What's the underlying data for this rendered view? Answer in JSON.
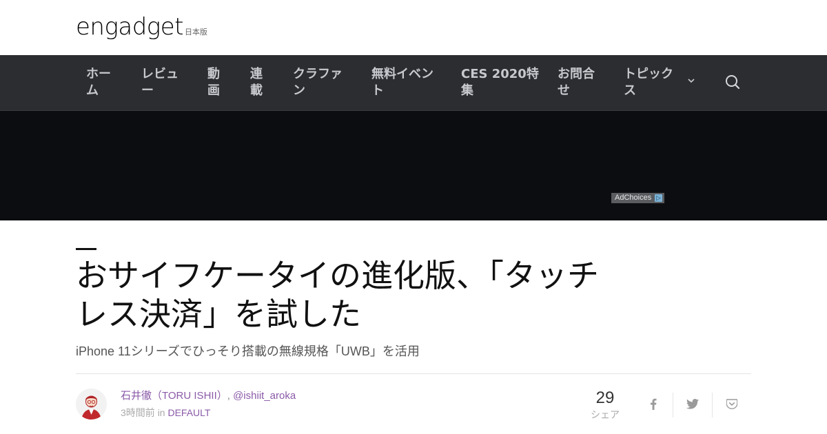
{
  "header": {
    "logo_text": "engadget",
    "edition": "日本版"
  },
  "nav": {
    "items": [
      {
        "line1": "ホー",
        "line2": "ム"
      },
      {
        "line1": "レビュ",
        "line2": "ー"
      },
      {
        "line1": "動",
        "line2": "画"
      },
      {
        "line1": "連",
        "line2": "載"
      },
      {
        "line1": "クラファ",
        "line2": "ン"
      },
      {
        "line1": "無料イベン",
        "line2": "ト"
      },
      {
        "line1": "CES 2020特",
        "line2": "集"
      },
      {
        "line1": "お問合",
        "line2": "せ"
      },
      {
        "line1": "トピック",
        "line2": "ス"
      }
    ],
    "dropdown_icon": "chevron-down-icon",
    "search_icon": "search-icon"
  },
  "ad": {
    "adchoices_label": "AdChoices",
    "adchoices_glyph": "▷"
  },
  "article": {
    "headline_line1": "おサイフケータイの進化版、「タッチ",
    "headline_line2": "レス決済」を試した",
    "subheadline": "iPhone 11シリーズでひっそり搭載の無線規格「UWB」を活用",
    "author_name": "石井徹（TORU ISHII）",
    "author_separator": ",",
    "author_handle": "@ishiit_aroka",
    "time_ago": "3時間前",
    "in_word": "in",
    "category": "DEFAULT"
  },
  "share": {
    "count": "29",
    "label": "シェア",
    "icons": [
      "facebook-icon",
      "twitter-icon",
      "pocket-icon"
    ]
  },
  "colors": {
    "nav_bg": "#2c2d31",
    "ad_bg": "#0c0d10",
    "link_purple": "#8a5aa8"
  }
}
